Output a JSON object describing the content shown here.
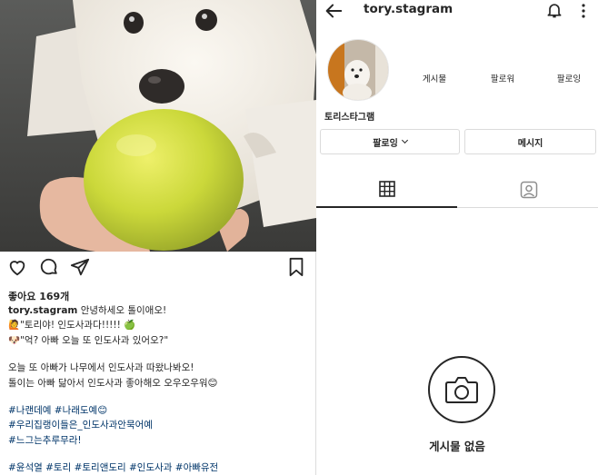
{
  "post": {
    "likes_label": "좋아요 169개",
    "caption": {
      "username": "tory.stagram",
      "text": "안녕하세오 톨이애오!",
      "lines": [
        "🙋\"토리야! 인도사과다!!!!! 🍏",
        "🐶\"억? 아빠 오늘 또 인도사과 있어오?\"",
        "",
        "오늘 또 아빠가 나무에서 인도사과 따왔나봐오!",
        "톨이는 아빠 닮아서 인도사과 좋아해오 오우오우워😊"
      ],
      "hashtags": [
        "#나랜데예 #나래도예😊",
        "#우리집랭이들은_인도사과안묵어예",
        "#느그는추루무라!",
        "",
        "#윤석열 #토리 #토리앤도리 #인도사과 #아빠유전"
      ]
    },
    "icons": {
      "like": "heart-icon",
      "comment": "comment-icon",
      "share": "share-icon",
      "save": "bookmark-icon"
    }
  },
  "profile": {
    "username": "tory.stagram",
    "display_name": "토리스타그램",
    "stats": {
      "posts_label": "게시물",
      "followers_label": "팔로워",
      "following_label": "팔로잉"
    },
    "following_button_label": "팔로잉",
    "message_button_label": "메시지",
    "empty_state_label": "게시물 없음",
    "icons": {
      "back": "back-arrow-icon",
      "bell": "bell-icon",
      "more": "more-icon",
      "grid": "grid-icon",
      "tagged": "tagged-icon",
      "camera": "camera-icon"
    }
  },
  "colors": {
    "text": "#262626",
    "hashtag": "#003569",
    "border": "#dbdbdb",
    "apple": "#c9d63a"
  }
}
